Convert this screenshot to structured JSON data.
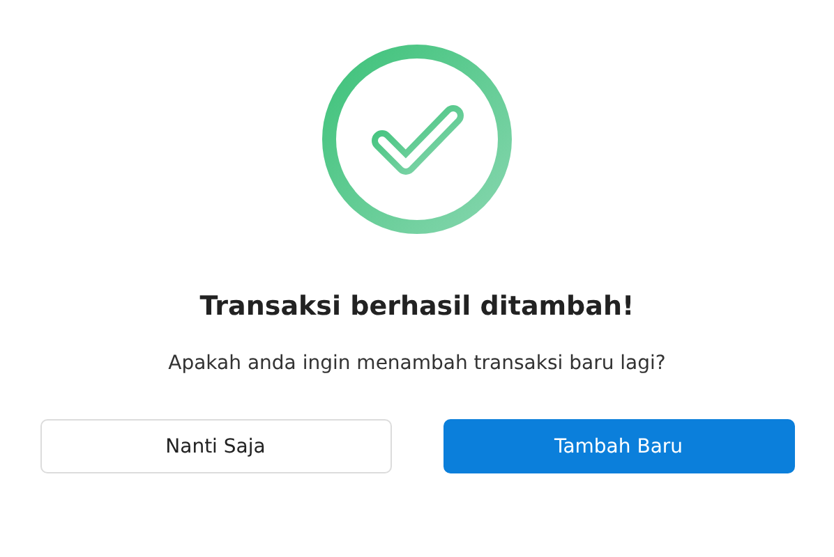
{
  "dialog": {
    "title": "Transaksi berhasil ditambah!",
    "message": "Apakah anda ingin menambah transaksi baru lagi?",
    "buttons": [
      {
        "label": "Nanti Saja",
        "kind": "secondary"
      },
      {
        "label": "Tambah Baru",
        "kind": "primary"
      }
    ]
  }
}
